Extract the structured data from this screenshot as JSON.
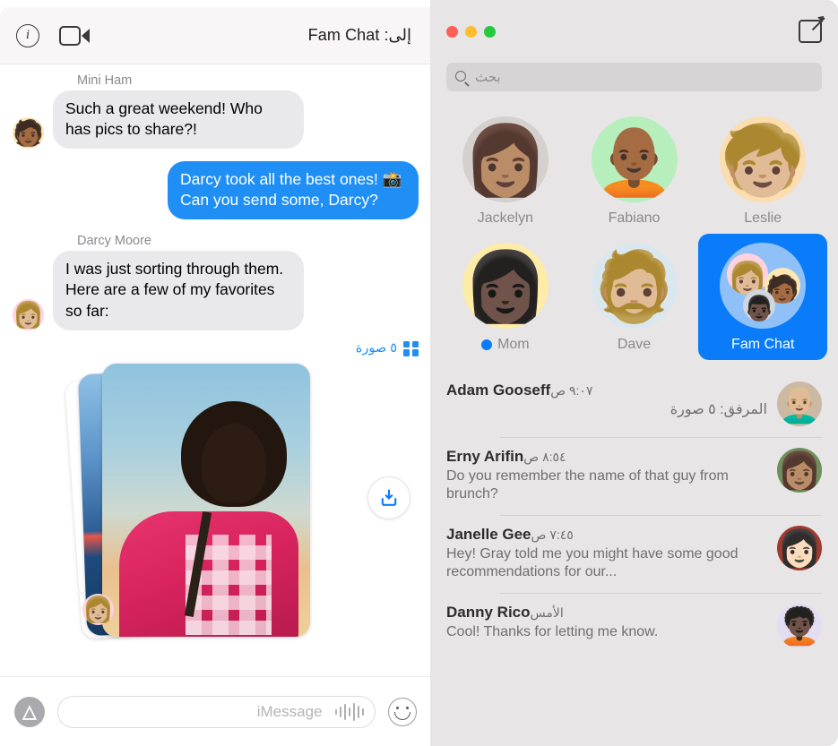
{
  "conversation": {
    "header": {
      "info_icon": "info-icon",
      "facetime_icon": "facetime-video-icon",
      "title": "إلى: Fam Chat"
    },
    "messages": [
      {
        "sender": "Mini Ham",
        "text": "Such a great weekend! Who has pics to share?!",
        "direction": "incoming",
        "avatar_glyph": "🧑🏾"
      },
      {
        "sender": "",
        "text": "Darcy took all the best ones! 📸 Can you send some, Darcy?",
        "direction": "outgoing",
        "avatar_glyph": ""
      },
      {
        "sender": "Darcy Moore",
        "text": "I was just sorting through them. Here are a few of my favorites so far:",
        "direction": "incoming",
        "avatar_glyph": "👩🏼"
      }
    ],
    "attachment": {
      "count_label": "٥ صورة",
      "grid_icon": "photo-grid-icon",
      "download_icon": "download-icon"
    },
    "compose": {
      "apps_icon": "app-store-icon",
      "placeholder": "iMessage",
      "value": "",
      "audio_icon": "audio-waveform-icon",
      "emoji_icon": "smiley-face-icon"
    }
  },
  "sidebar": {
    "compose_icon": "compose-new-message-icon",
    "window_controls": [
      {
        "name": "zoom-button",
        "color": "#27c93f"
      },
      {
        "name": "minimize-button",
        "color": "#ffbd2e"
      },
      {
        "name": "close-button",
        "color": "#ff5f56"
      }
    ],
    "search": {
      "placeholder": "بحث",
      "value": "",
      "icon": "search-icon"
    },
    "pinned": [
      {
        "label": "Leslie",
        "glyph": "🧒🏼",
        "bg": "#fbddb0",
        "selected": false,
        "unread": false
      },
      {
        "label": "Fabiano",
        "glyph": "🧑🏾‍🦲",
        "bg": "#b6efbc",
        "selected": false,
        "unread": false
      },
      {
        "label": "Jackelyn",
        "glyph": "👩🏽",
        "bg": "#cfcfcf",
        "selected": false,
        "unread": false
      },
      {
        "label": "Fam Chat",
        "glyph": "",
        "bg": "#8fc0f7",
        "selected": true,
        "unread": false
      },
      {
        "label": "Dave",
        "glyph": "🧔🏼",
        "bg": "#dbe7ef",
        "selected": false,
        "unread": false
      },
      {
        "label": "Mom",
        "glyph": "👩🏿",
        "bg": "#fdeba8",
        "selected": false,
        "unread": true
      }
    ],
    "conversations": [
      {
        "name": "Adam Gooseff",
        "time": "٩:٠٧ ص",
        "preview": "المرفق: ٥ صورة",
        "preview_dir": "rtl",
        "glyph": "👨🏼‍🦲",
        "avatar_bg": "#cbb9a3"
      },
      {
        "name": "Erny Arifin",
        "time": "٨:٥٤ ص",
        "preview": "Do you remember the name of that guy from brunch?",
        "preview_dir": "ltr",
        "glyph": "👩🏽",
        "avatar_bg": "#6f8f5a"
      },
      {
        "name": "Janelle Gee",
        "time": "٧:٤٥ ص",
        "preview": "Hey! Gray told me you might have some good recommendations for our...",
        "preview_dir": "ltr",
        "glyph": "👩🏻",
        "avatar_bg": "#a03a2f"
      },
      {
        "name": "Danny Rico",
        "time": "الأمس",
        "preview": "Cool! Thanks for letting me know.",
        "preview_dir": "ltr",
        "glyph": "🧑🏿‍🦱",
        "avatar_bg": "#e4ddf2"
      }
    ]
  },
  "colors": {
    "accent_blue": "#0a7cf9",
    "bubble_out": "#1f8ff5",
    "bubble_in": "#e9e9eb",
    "sidebar_bg": "#e7e5e6"
  }
}
